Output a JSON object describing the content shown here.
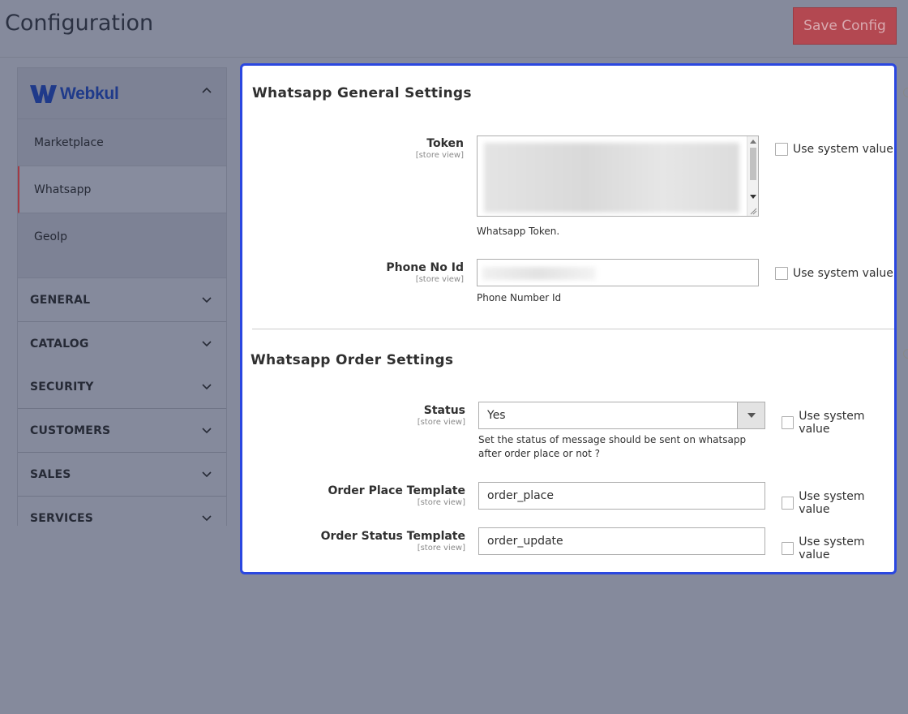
{
  "header": {
    "title": "Configuration",
    "save_label": "Save Config"
  },
  "sidebar": {
    "brand": "Webkul",
    "items": [
      {
        "label": "Marketplace"
      },
      {
        "label": "Whatsapp"
      },
      {
        "label": "GeoIp"
      }
    ],
    "sections": [
      {
        "label": "GENERAL"
      },
      {
        "label": "CATALOG"
      },
      {
        "label": "SECURITY"
      },
      {
        "label": "CUSTOMERS"
      },
      {
        "label": "SALES"
      },
      {
        "label": "SERVICES"
      }
    ]
  },
  "general": {
    "title": "Whatsapp General Settings",
    "token": {
      "label": "Token",
      "scope": "[store view]",
      "note": "Whatsapp Token.",
      "system_label": "Use system value"
    },
    "phone": {
      "label": "Phone No Id",
      "scope": "[store view]",
      "note": "Phone Number Id",
      "system_label": "Use system value"
    }
  },
  "order": {
    "title": "Whatsapp Order Settings",
    "status": {
      "label": "Status",
      "scope": "[store view]",
      "value": "Yes",
      "note": "Set the status of message should be sent on whatsapp after order place or not ?",
      "system_label": "Use system value"
    },
    "place": {
      "label": "Order Place Template",
      "scope": "[store view]",
      "value": "order_place",
      "system_label": "Use system value"
    },
    "update": {
      "label": "Order Status Template",
      "scope": "[store view]",
      "value": "order_update",
      "system_label": "Use system value"
    }
  }
}
